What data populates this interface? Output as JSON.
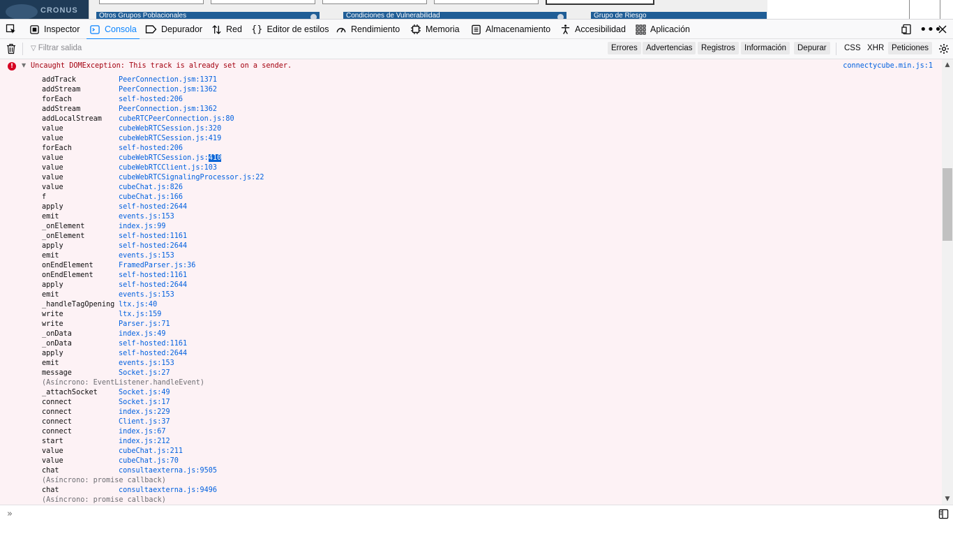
{
  "page_behind": {
    "logo_text": "CRONUS",
    "panels": [
      "Otros Grupos Poblacionales",
      "Condiciones de Vulnerabilidad",
      "Grupo de Riesgo"
    ]
  },
  "toolbar": {
    "tabs": [
      {
        "label": "Inspector",
        "icon": "inspector-icon"
      },
      {
        "label": "Consola",
        "icon": "console-icon",
        "selected": true
      },
      {
        "label": "Depurador",
        "icon": "debugger-icon"
      },
      {
        "label": "Red",
        "icon": "network-icon"
      },
      {
        "label": "Editor de estilos",
        "icon": "style-editor-icon"
      },
      {
        "label": "Rendimiento",
        "icon": "performance-icon"
      },
      {
        "label": "Memoria",
        "icon": "memory-icon"
      },
      {
        "label": "Almacenamiento",
        "icon": "storage-icon"
      },
      {
        "label": "Accesibilidad",
        "icon": "accessibility-icon"
      },
      {
        "label": "Aplicación",
        "icon": "application-icon"
      }
    ]
  },
  "filter": {
    "placeholder": "Filtrar salida",
    "levels": [
      "Errores",
      "Advertencias",
      "Registros",
      "Información",
      "Depurar"
    ],
    "extra": [
      "CSS",
      "XHR",
      "Peticiones"
    ]
  },
  "error": {
    "message": "Uncaught DOMException: This track is already set on a sender.",
    "source": "connectycube.min.js:1",
    "stack": [
      {
        "fn": "addTrack",
        "loc": "PeerConnection.jsm:1371"
      },
      {
        "fn": "addStream",
        "loc": "PeerConnection.jsm:1362"
      },
      {
        "fn": "forEach",
        "loc": "self-hosted:206"
      },
      {
        "fn": "addStream",
        "loc": "PeerConnection.jsm:1362"
      },
      {
        "fn": "addLocalStream",
        "loc": "cubeRTCPeerConnection.js:80"
      },
      {
        "fn": "value",
        "loc": "cubeWebRTCSession.js:320"
      },
      {
        "fn": "value",
        "loc": "cubeWebRTCSession.js:419"
      },
      {
        "fn": "forEach",
        "loc": "self-hosted:206"
      },
      {
        "fn": "value",
        "loc": "cubeWebRTCSession.js:",
        "hl": "410"
      },
      {
        "fn": "value",
        "loc": "cubeWebRTCClient.js:103"
      },
      {
        "fn": "value",
        "loc": "cubeWebRTCSignalingProcessor.js:22"
      },
      {
        "fn": "value",
        "loc": "cubeChat.js:826"
      },
      {
        "fn": "f",
        "loc": "cubeChat.js:166"
      },
      {
        "fn": "apply",
        "loc": "self-hosted:2644"
      },
      {
        "fn": "emit",
        "loc": "events.js:153"
      },
      {
        "fn": "_onElement",
        "loc": "index.js:99"
      },
      {
        "fn": "_onElement",
        "loc": "self-hosted:1161"
      },
      {
        "fn": "apply",
        "loc": "self-hosted:2644"
      },
      {
        "fn": "emit",
        "loc": "events.js:153"
      },
      {
        "fn": "onEndElement",
        "loc": "FramedParser.js:36"
      },
      {
        "fn": "onEndElement",
        "loc": "self-hosted:1161"
      },
      {
        "fn": "apply",
        "loc": "self-hosted:2644"
      },
      {
        "fn": "emit",
        "loc": "events.js:153"
      },
      {
        "fn": "_handleTagOpening",
        "loc": "ltx.js:40"
      },
      {
        "fn": "write",
        "loc": "ltx.js:159"
      },
      {
        "fn": "write",
        "loc": "Parser.js:71"
      },
      {
        "fn": "_onData",
        "loc": "index.js:49"
      },
      {
        "fn": "_onData",
        "loc": "self-hosted:1161"
      },
      {
        "fn": "apply",
        "loc": "self-hosted:2644"
      },
      {
        "fn": "emit",
        "loc": "events.js:153"
      },
      {
        "fn": "message",
        "loc": "Socket.js:27"
      },
      {
        "async": "(Asíncrono: EventListener.handleEvent)"
      },
      {
        "fn": "_attachSocket",
        "loc": "Socket.js:49"
      },
      {
        "fn": "connect",
        "loc": "Socket.js:17"
      },
      {
        "fn": "connect",
        "loc": "index.js:229"
      },
      {
        "fn": "connect",
        "loc": "Client.js:37"
      },
      {
        "fn": "connect",
        "loc": "index.js:67"
      },
      {
        "fn": "start",
        "loc": "index.js:212"
      },
      {
        "fn": "value",
        "loc": "cubeChat.js:211"
      },
      {
        "fn": "value",
        "loc": "cubeChat.js:70"
      },
      {
        "fn": "chat",
        "loc": "consultaexterna.js:9505"
      },
      {
        "async": "(Asíncrono: promise callback)"
      },
      {
        "fn": "chat",
        "loc": "consultaexterna.js:9496"
      },
      {
        "async": "(Asíncrono: promise callback)"
      }
    ]
  },
  "input": {
    "prompt": "»"
  }
}
